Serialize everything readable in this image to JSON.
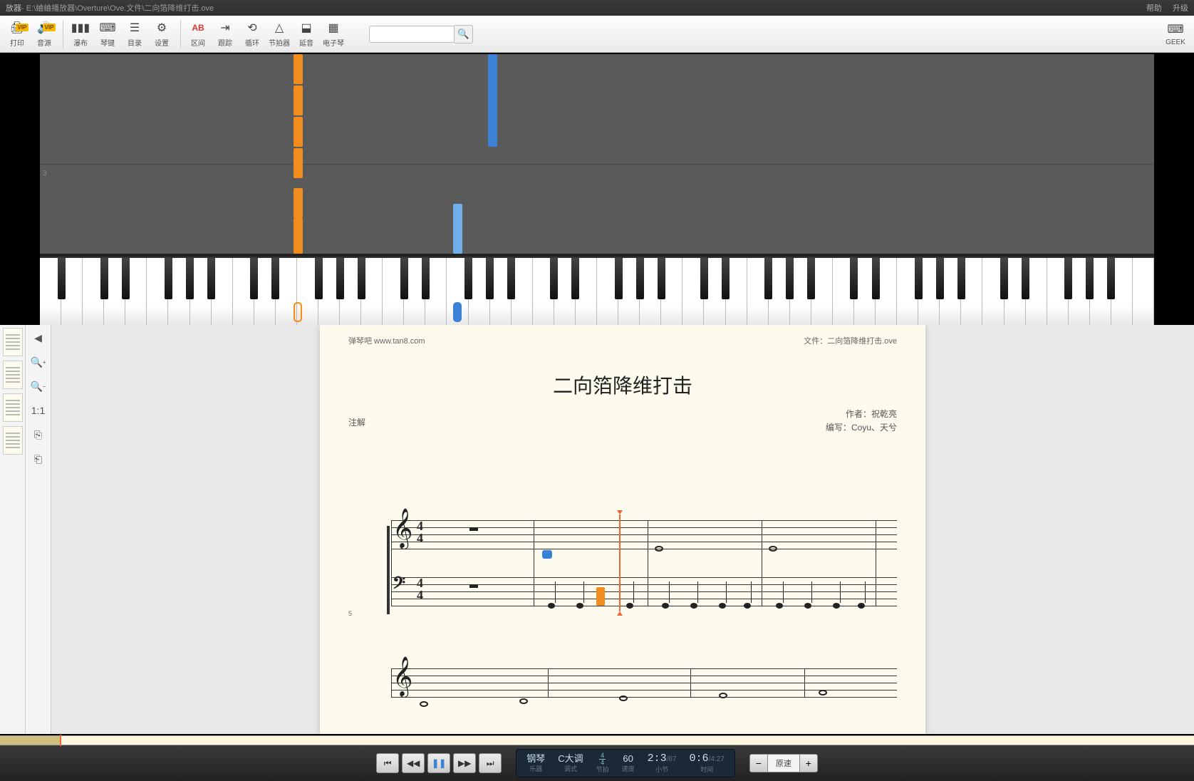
{
  "titlebar": {
    "app_fragment": "放器",
    "path": " - E:\\蛐蛐播放器\\Overture\\Ove.文件\\二向箔降维打击.ove",
    "menu": {
      "help": "帮助",
      "upgrade": "升级"
    }
  },
  "toolbar": {
    "print": "打印",
    "sound": "音源",
    "waterfall": "瀑布",
    "keys": "琴键",
    "catalog": "目录",
    "settings": "设置",
    "section": "区间",
    "follow": "跟踪",
    "loop": "循环",
    "metronome": "节拍器",
    "sustain": "延音",
    "epiano": "电子琴",
    "geek": "GEEK",
    "vip_badge": "VIP",
    "search_placeholder": ""
  },
  "waterfall": {
    "row_label": "3"
  },
  "score": {
    "site": "弹琴吧  www.tan8.com",
    "file_label": "文件：二向箔降维打击.ove",
    "title": "二向箔降维打击",
    "note_label": "注解",
    "author_line": "作者：祝乾亮",
    "arranger_line": "编写：Coyu、天兮",
    "time_sig_num": "4",
    "time_sig_den": "4",
    "measure5": "5"
  },
  "status": {
    "instrument": "钢琴",
    "instrument_sub": "乐器",
    "key": "C大调",
    "key_sub": "调式",
    "beat_num": "4",
    "beat_den": "4",
    "beat_sub": "节拍",
    "tempo": "60",
    "tempo_sub": "速度",
    "measure_pos": "2:3",
    "measure_total": "/67",
    "measure_sub": "小节",
    "time_pos": "0:6",
    "time_total": "/4:27",
    "time_sub": "时间"
  },
  "speed": {
    "label": "原速"
  },
  "side_tools": {
    "collapse": "◀",
    "zoom_in": "+",
    "zoom_out": "−",
    "fit": "1:1",
    "export": "⎘",
    "page": "⎗"
  }
}
